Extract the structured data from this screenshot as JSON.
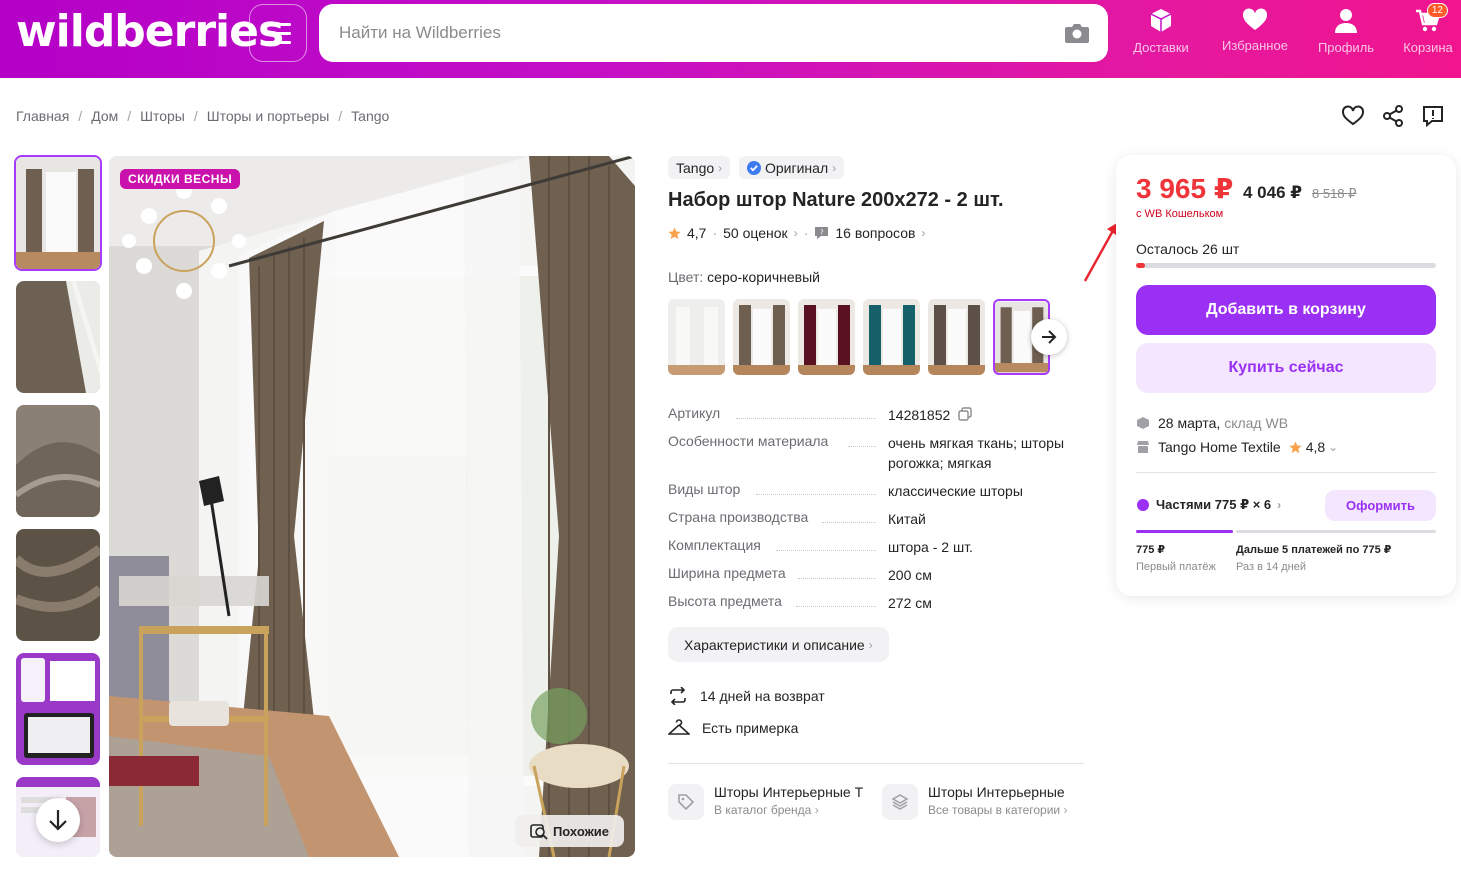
{
  "header": {
    "logo": "wildberries",
    "search_placeholder": "Найти на Wildberries",
    "nav": [
      {
        "label": "Доставки",
        "icon": "box-icon"
      },
      {
        "label": "Избранное",
        "icon": "heart-icon"
      },
      {
        "label": "Профиль",
        "icon": "user-icon"
      },
      {
        "label": "Корзина",
        "icon": "cart-icon",
        "badge": "12"
      }
    ]
  },
  "breadcrumb": [
    "Главная",
    "Дом",
    "Шторы",
    "Шторы и портьеры",
    "Tango"
  ],
  "gallery": {
    "promo_label": "СКИДКИ ВЕСНЫ",
    "similar_label": "Похожие"
  },
  "product": {
    "brand": "Tango",
    "original_label": "Оригинал",
    "title": "Набор штор Nature 200x272 - 2 шт.",
    "rating": "4,7",
    "reviews": "50 оценок",
    "questions": "16 вопросов",
    "color_label": "Цвет:",
    "color_value": "серо-коричневый",
    "specs": [
      {
        "key": "Артикул",
        "value": "14281852"
      },
      {
        "key": "Особенности материала",
        "value": "очень мягкая ткань; шторы рогожка; мягкая"
      },
      {
        "key": "Виды штор",
        "value": "классические шторы"
      },
      {
        "key": "Страна производства",
        "value": "Китай"
      },
      {
        "key": "Комплектация",
        "value": "штора - 2 шт."
      },
      {
        "key": "Ширина предмета",
        "value": "200 см"
      },
      {
        "key": "Высота предмета",
        "value": "272 см"
      }
    ],
    "desc_button": "Характеристики и описание",
    "return_policy": "14 дней на возврат",
    "fitting": "Есть примерка",
    "brand_link_title": "Шторы Интерьерные Т",
    "brand_link_sub": "В каталог бренда",
    "category_link_title": "Шторы Интерьерные",
    "category_link_sub": "Все товары в категории"
  },
  "price_card": {
    "price_wallet": "3 965 ₽",
    "price": "4 046 ₽",
    "price_old": "8 518 ₽",
    "wallet_note": "с WB Кошельком",
    "stock_text": "Осталось 26 шт",
    "stock_fraction": 0.03,
    "add_to_cart": "Добавить в корзину",
    "buy_now": "Купить сейчас",
    "delivery_date": "28 марта,",
    "delivery_warehouse": "склад WB",
    "seller": "Tango Home Textile",
    "seller_rating": "4,8",
    "installment_label": "Частями 775 ₽ × 6",
    "order_button": "Оформить",
    "first_payment_value": "775 ₽",
    "first_payment_label": "Первый платёж",
    "next_payments_value": "Дальше 5 платежей по 775 ₽",
    "next_payments_label": "Раз в 14 дней"
  },
  "colors": {
    "brand_purple": "#9b30f5",
    "price_red": "#f0353a",
    "promo_magenta": "#cb11ab"
  }
}
